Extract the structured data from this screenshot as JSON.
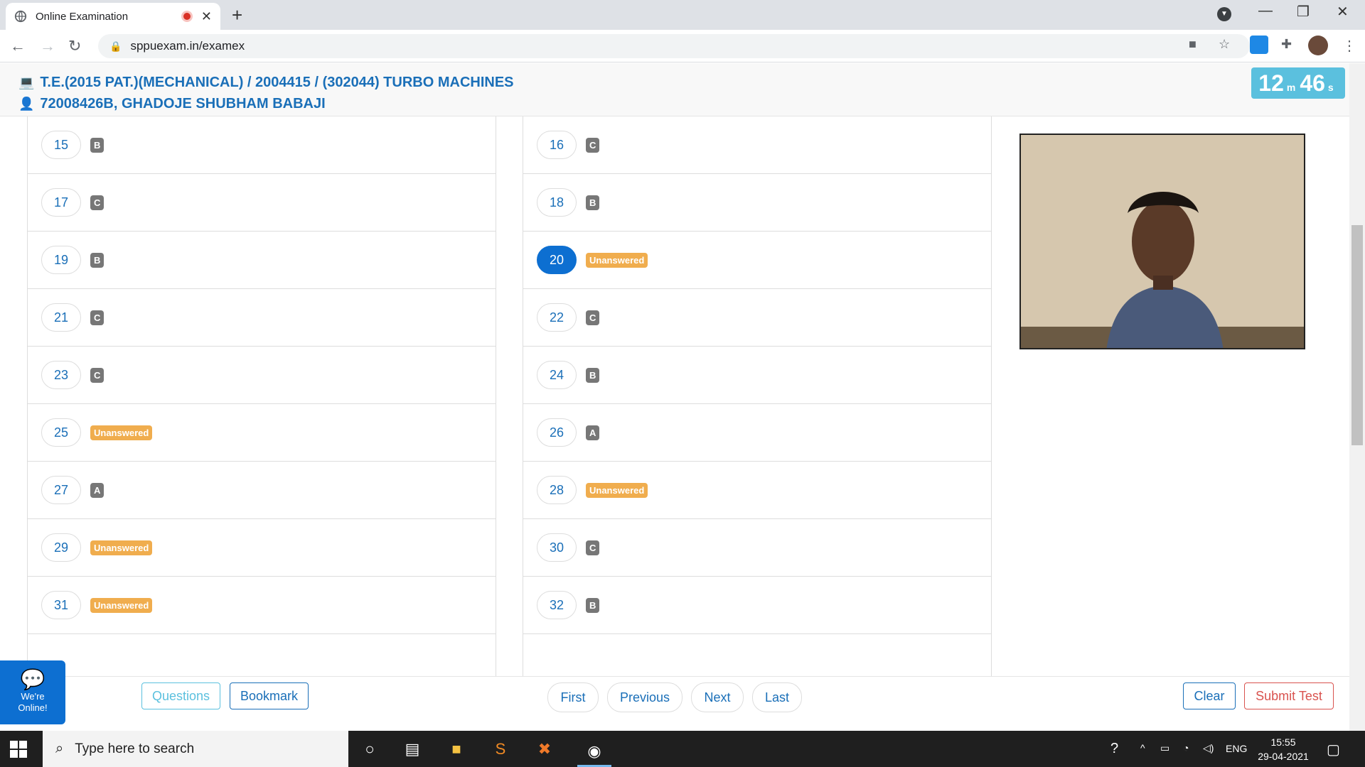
{
  "browser": {
    "tab_title": "Online Examination",
    "url": "sppuexam.in/examex"
  },
  "header": {
    "exam_title": "T.E.(2015 PAT.)(MECHANICAL) / 2004415 / (302044) TURBO MACHINES",
    "student": "72008426B, GHADOJE SHUBHAM BABAJI",
    "timer_minutes": "12",
    "timer_min_unit": "m",
    "timer_seconds": "46",
    "timer_sec_unit": "s"
  },
  "questions": {
    "left": [
      {
        "num": "15",
        "answer": "B",
        "status": "answered"
      },
      {
        "num": "17",
        "answer": "C",
        "status": "answered"
      },
      {
        "num": "19",
        "answer": "B",
        "status": "answered"
      },
      {
        "num": "21",
        "answer": "C",
        "status": "answered"
      },
      {
        "num": "23",
        "answer": "C",
        "status": "answered"
      },
      {
        "num": "25",
        "answer": "Unanswered",
        "status": "unanswered"
      },
      {
        "num": "27",
        "answer": "A",
        "status": "answered"
      },
      {
        "num": "29",
        "answer": "Unanswered",
        "status": "unanswered"
      },
      {
        "num": "31",
        "answer": "Unanswered",
        "status": "unanswered"
      }
    ],
    "right": [
      {
        "num": "16",
        "answer": "C",
        "status": "answered"
      },
      {
        "num": "18",
        "answer": "B",
        "status": "answered"
      },
      {
        "num": "20",
        "answer": "Unanswered",
        "status": "unanswered",
        "active": true
      },
      {
        "num": "22",
        "answer": "C",
        "status": "answered"
      },
      {
        "num": "24",
        "answer": "B",
        "status": "answered"
      },
      {
        "num": "26",
        "answer": "A",
        "status": "answered"
      },
      {
        "num": "28",
        "answer": "Unanswered",
        "status": "unanswered"
      },
      {
        "num": "30",
        "answer": "C",
        "status": "answered"
      },
      {
        "num": "32",
        "answer": "B",
        "status": "answered"
      }
    ]
  },
  "buttons": {
    "questions": "Questions",
    "bookmark": "Bookmark",
    "first": "First",
    "previous": "Previous",
    "next": "Next",
    "last": "Last",
    "clear": "Clear",
    "submit": "Submit Test"
  },
  "chat": {
    "label_line1": "We're",
    "label_line2": "Online!"
  },
  "taskbar": {
    "search_placeholder": "Type here to search",
    "lang": "ENG",
    "time": "15:55",
    "date": "29-04-2021"
  },
  "colors": {
    "primary": "#1a6fb8",
    "info": "#5bc0de",
    "danger": "#d9534f",
    "warning": "#f0ad4e",
    "badge": "#777777"
  }
}
